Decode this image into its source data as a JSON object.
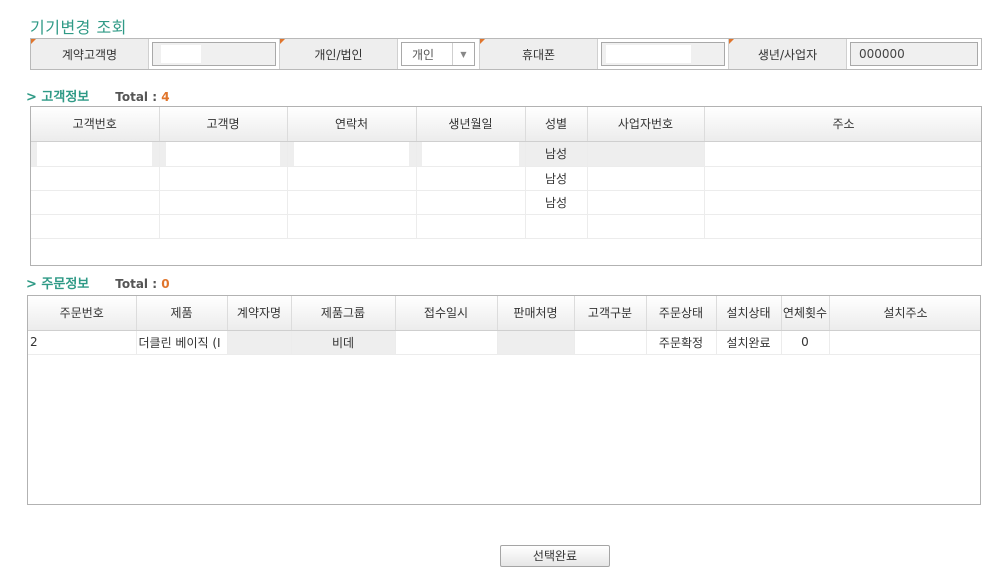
{
  "page_title": "기기변경 조회",
  "search": {
    "contract_name_label": "계약고객명",
    "contract_name_value": "",
    "type_label": "개인/법인",
    "type_value": "개인",
    "phone_label": "휴대폰",
    "phone_value": "",
    "birth_label": "생년/사업자",
    "birth_value": "000000"
  },
  "customer": {
    "title": "> 고객정보",
    "total_label": "Total : ",
    "total_count": "4",
    "columns": [
      "고객번호",
      "고객명",
      "연락처",
      "생년월일",
      "성별",
      "사업자번호",
      "주소"
    ],
    "rows": [
      {
        "gender": "남성"
      },
      {
        "gender": "남성"
      },
      {
        "gender": "남성"
      },
      {
        "gender": ""
      }
    ]
  },
  "order": {
    "title": "> 주문정보",
    "total_label": "Total : ",
    "total_count": "0",
    "columns": [
      "주문번호",
      "제품",
      "계약자명",
      "제품그룹",
      "접수일시",
      "판매처명",
      "고객구분",
      "주문상태",
      "설치상태",
      "연체횟수",
      "설치주소"
    ],
    "row": {
      "order_no": "2",
      "product": "더클린 베이직 (I",
      "contractor": "",
      "product_group": "비데",
      "received": "",
      "store": "",
      "cust_type": "",
      "order_status": "주문확정",
      "install_status": "설치완료",
      "overdue": "0",
      "address": ""
    }
  },
  "select_button": "선택완료"
}
